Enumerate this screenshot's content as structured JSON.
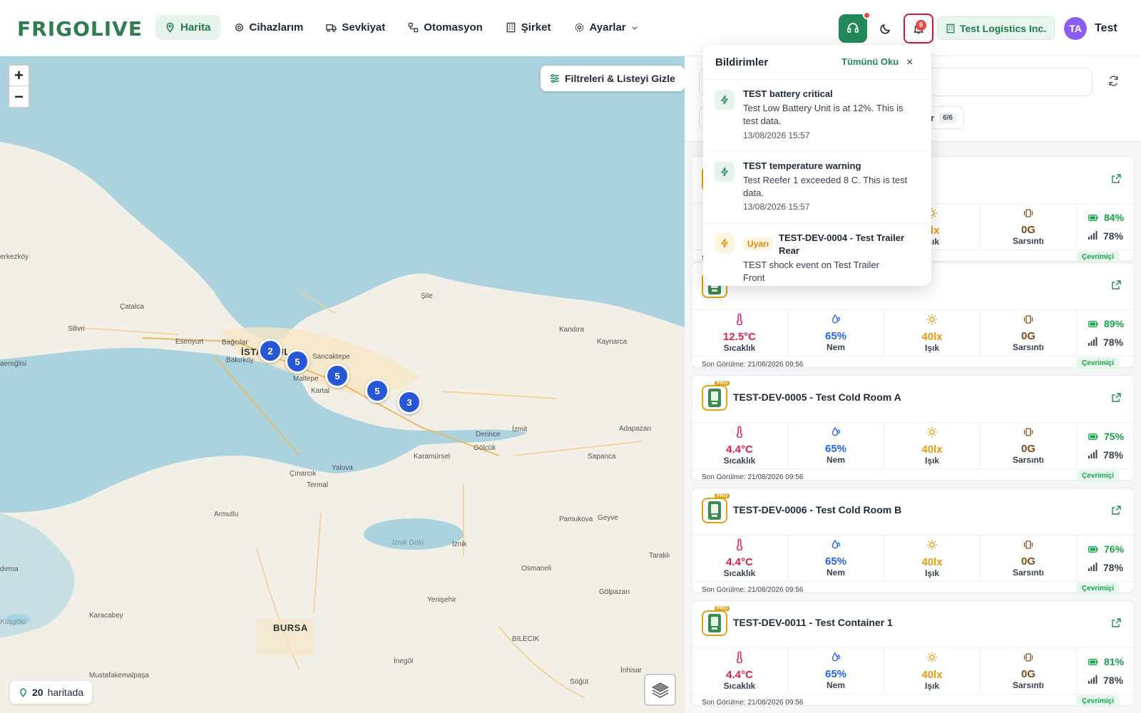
{
  "brand": {
    "logo": "FRIGOLIVE",
    "accent": "#23885a"
  },
  "nav": [
    {
      "label": "Harita",
      "icon": "map-pin-icon",
      "active": true
    },
    {
      "label": "Cihazlarım",
      "icon": "chip-icon"
    },
    {
      "label": "Sevkiyat",
      "icon": "truck-icon"
    },
    {
      "label": "Otomasyon",
      "icon": "flow-icon"
    },
    {
      "label": "Şirket",
      "icon": "building-icon"
    },
    {
      "label": "Ayarlar",
      "icon": "gear-icon"
    }
  ],
  "header": {
    "notification_count": "6",
    "company": "Test Logistics Inc.",
    "avatar_initials": "TA",
    "user_name": "Test"
  },
  "map": {
    "filter_button": "Filtreleri & Listeyi Gizle",
    "count_value": "20",
    "count_label": "haritada",
    "clusters": [
      "2",
      "5",
      "5",
      "5",
      "3"
    ],
    "places": [
      "Şile",
      "Çatalca",
      "Silivri",
      "Esenyurt",
      "Bağcılar",
      "İSTANBUL",
      "Bakırköy",
      "Sancaktepe",
      "Maltepe",
      "Kartal",
      "Kandıra",
      "Kaynarca",
      "erkezköy",
      "aereğlisi",
      "Derince",
      "İzmit",
      "Gölcük",
      "Adapazarı",
      "Karamürsel",
      "Sapanca",
      "Çınarcık",
      "Yalova",
      "Termal",
      "Armutlu",
      "Pamukova",
      "Geyve",
      "İznik Gölü",
      "İznik",
      "Taraklı",
      "Osmaneli",
      "dırma",
      "Gölpazarı",
      "Yenişehir",
      "Karacabey",
      "Kuşgölü",
      "BURSA",
      "BILECIK",
      "İnegöl",
      "Mustafakemalpaşa",
      "İnhisar",
      "Söğüt"
    ]
  },
  "panel": {
    "chip_label": "er",
    "chip_count": "6/6",
    "cards": [
      {
        "title": "",
        "temp": "",
        "hum": "",
        "light": "0lx",
        "shock": "0G",
        "battery": "84%",
        "signal": "78%",
        "seen": "So",
        "status": "Çevrimiçi"
      },
      {
        "title": "",
        "temp": "12.5°C",
        "hum": "65%",
        "light": "40lx",
        "shock": "0G",
        "battery": "89%",
        "signal": "78%",
        "seen": "Son Görülme: 21/08/2026 09:56",
        "status": "Çevrimiçi"
      },
      {
        "title": "TEST-DEV-0005 - Test Cold Room A",
        "temp": "4.4°C",
        "hum": "65%",
        "light": "40lx",
        "shock": "0G",
        "battery": "75%",
        "signal": "78%",
        "seen": "Son Görülme: 21/08/2026 09:56",
        "status": "Çevrimiçi"
      },
      {
        "title": "TEST-DEV-0006 - Test Cold Room B",
        "temp": "4.4°C",
        "hum": "65%",
        "light": "40lx",
        "shock": "0G",
        "battery": "76%",
        "signal": "78%",
        "seen": "Son Görülme: 21/08/2026 09:56",
        "status": "Çevrimiçi"
      },
      {
        "title": "TEST-DEV-0011 - Test Container 1",
        "temp": "4.4°C",
        "hum": "65%",
        "light": "40lx",
        "shock": "0G",
        "battery": "81%",
        "signal": "78%",
        "seen": "Son Görülme: 21/08/2026 09:56",
        "status": "Çevrimiçi"
      }
    ],
    "labels": {
      "temp": "Sıcaklık",
      "hum": "Nem",
      "light": "Işık",
      "shock": "Sarsıntı",
      "pro": "PRO"
    }
  },
  "notifications": {
    "title": "Bildirimler",
    "read_all": "Tümünü Oku",
    "close": "×",
    "items": [
      {
        "title": "TEST battery critical",
        "body": "Test Low Battery Unit is at 12%. This is test data.",
        "time": "13/08/2026 15:57"
      },
      {
        "title": "TEST temperature warning",
        "body": "Test Reefer 1 exceeded 8 C. This is test data.",
        "time": "13/08/2026 15:57"
      },
      {
        "tag": "Uyarı",
        "title": "TEST-DEV-0004 - Test Trailer Rear",
        "body": "TEST shock event on Test Trailer Front",
        "time": ""
      }
    ]
  },
  "colors": {
    "temp": "#e11d48",
    "hum": "#2563eb",
    "light": "#e59a0b",
    "shock": "#7c4a1c",
    "battery": "#16a34a",
    "cluster": "#2757d6"
  }
}
